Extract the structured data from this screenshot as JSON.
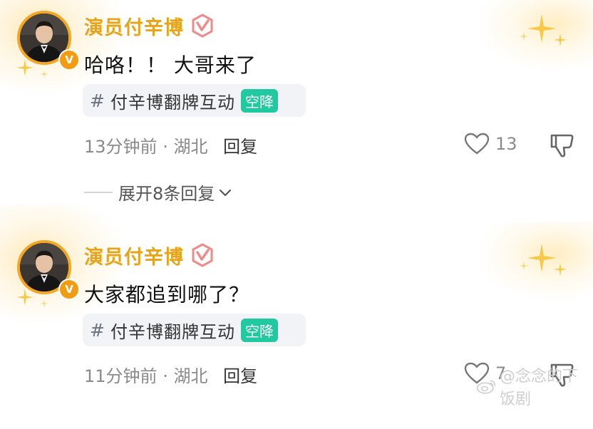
{
  "comments": [
    {
      "username": "演员付辛博",
      "verified_mark": "V",
      "text": "哈咯！！ 大哥来了",
      "topic": {
        "hash": "#",
        "name": "付辛博翻牌互动",
        "tag": "空降"
      },
      "time": "13分钟前",
      "location": "湖北",
      "reply_label": "回复",
      "likes": "13",
      "expand_label": "展开8条回复"
    },
    {
      "username": "演员付辛博",
      "verified_mark": "V",
      "text": "大家都追到哪了？",
      "topic": {
        "hash": "#",
        "name": "付辛博翻牌互动",
        "tag": "空降"
      },
      "time": "11分钟前",
      "location": "湖北",
      "reply_label": "回复",
      "likes": "7"
    }
  ],
  "separator": "·",
  "watermark": "@念念的下饭剧",
  "colors": {
    "username": "#e8a317",
    "verified": "#f39c12",
    "tag": "#20c9a0",
    "meta": "#8a8a8a",
    "topic_bg": "#f2f3f6"
  },
  "icons": [
    "verified-v-icon",
    "member-badge-icon",
    "heart-icon",
    "thumbs-down-icon",
    "chevron-down-icon",
    "weibo-icon",
    "sparkle-icon"
  ]
}
